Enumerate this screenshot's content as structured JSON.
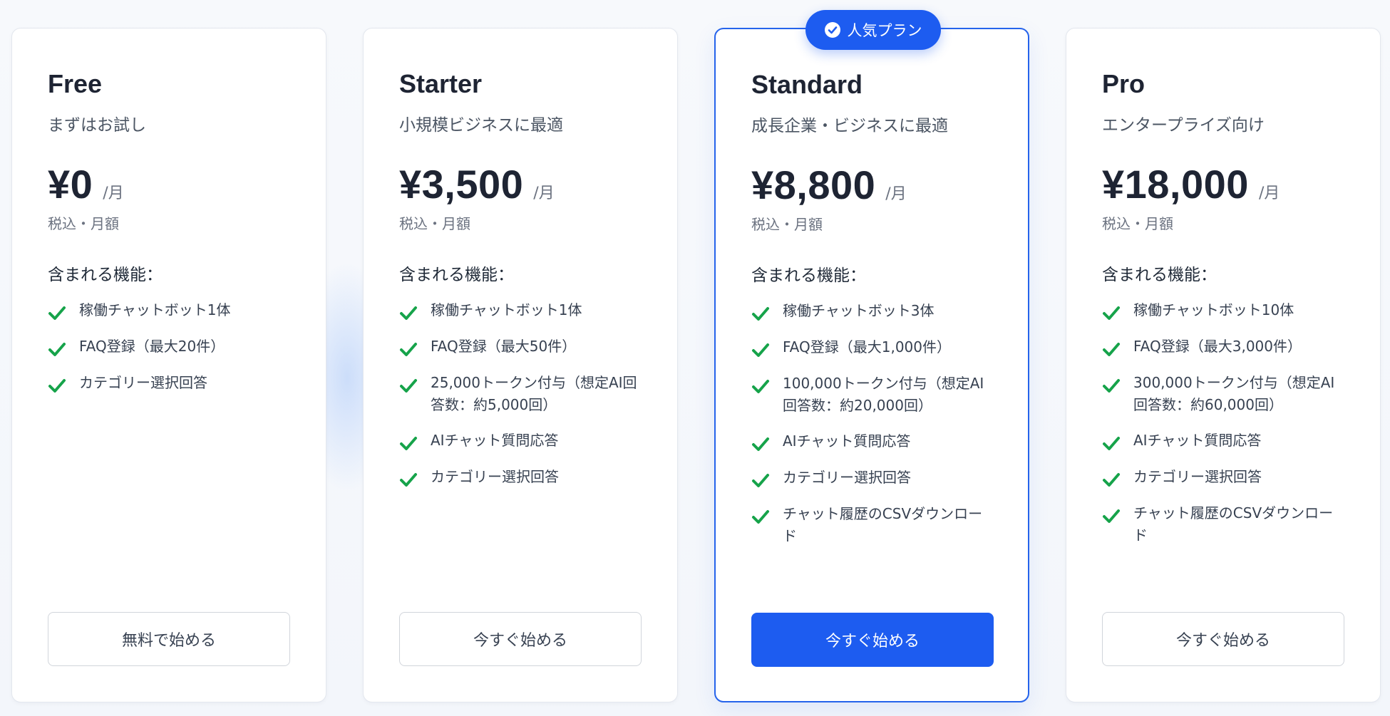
{
  "badge": {
    "label": "人気プラン",
    "icon": "check-circle-icon"
  },
  "accent_color": "#1d5cf0",
  "check_color": "#16a34a",
  "plans": [
    {
      "name": "Free",
      "tagline": "まずはお試し",
      "price": "¥0",
      "period": "/月",
      "tax_note": "税込・月額",
      "features_title": "含まれる機能：",
      "features": [
        "稼働チャットボット1体",
        "FAQ登録（最大20件）",
        "カテゴリー選択回答"
      ],
      "cta": "無料で始める"
    },
    {
      "name": "Starter",
      "tagline": "小規模ビジネスに最適",
      "price": "¥3,500",
      "period": "/月",
      "tax_note": "税込・月額",
      "features_title": "含まれる機能：",
      "features": [
        "稼働チャットボット1体",
        "FAQ登録（最大50件）",
        "25,000トークン付与（想定AI回答数：約5,000回）",
        "AIチャット質問応答",
        "カテゴリー選択回答"
      ],
      "cta": "今すぐ始める"
    },
    {
      "name": "Standard",
      "tagline": "成長企業・ビジネスに最適",
      "price": "¥8,800",
      "period": "/月",
      "tax_note": "税込・月額",
      "features_title": "含まれる機能：",
      "features": [
        "稼働チャットボット3体",
        "FAQ登録（最大1,000件）",
        "100,000トークン付与（想定AI回答数：約20,000回）",
        "AIチャット質問応答",
        "カテゴリー選択回答",
        "チャット履歴のCSVダウンロード"
      ],
      "cta": "今すぐ始める"
    },
    {
      "name": "Pro",
      "tagline": "エンタープライズ向け",
      "price": "¥18,000",
      "period": "/月",
      "tax_note": "税込・月額",
      "features_title": "含まれる機能：",
      "features": [
        "稼働チャットボット10体",
        "FAQ登録（最大3,000件）",
        "300,000トークン付与（想定AI回答数：約60,000回）",
        "AIチャット質問応答",
        "カテゴリー選択回答",
        "チャット履歴のCSVダウンロード"
      ],
      "cta": "今すぐ始める"
    }
  ]
}
